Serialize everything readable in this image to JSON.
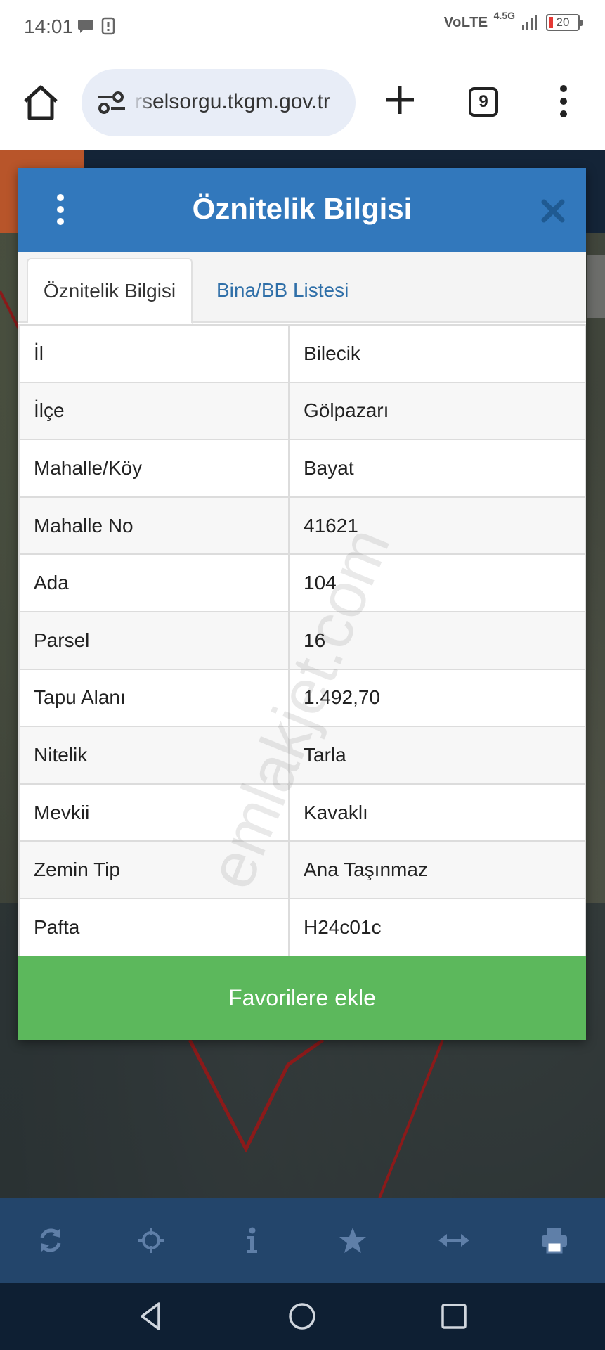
{
  "status_bar": {
    "time": "14:01",
    "volte": "VoLTE",
    "network": "4.5G",
    "battery": "20",
    "battery_color": "#e53935"
  },
  "browser": {
    "url": "rselsorgu.tkgm.gov.tr",
    "tab_count": "9",
    "icons": [
      "home-icon",
      "site-settings-icon",
      "new-tab-plus-icon",
      "tab-switcher-icon",
      "more-vert-icon"
    ]
  },
  "panel": {
    "title": "Öznitelik Bilgisi",
    "header_color": "#3278bc",
    "tabs": [
      {
        "label": "Öznitelik Bilgisi",
        "active": true
      },
      {
        "label": "Bina/BB Listesi",
        "active": false
      }
    ],
    "rows": [
      {
        "key": "İl",
        "value": "Bilecik"
      },
      {
        "key": "İlçe",
        "value": "Gölpazarı"
      },
      {
        "key": "Mahalle/Köy",
        "value": "Bayat"
      },
      {
        "key": "Mahalle No",
        "value": "41621"
      },
      {
        "key": "Ada",
        "value": "104"
      },
      {
        "key": "Parsel",
        "value": "16"
      },
      {
        "key": "Tapu Alanı",
        "value": "1.492,70"
      },
      {
        "key": "Nitelik",
        "value": "Tarla"
      },
      {
        "key": "Mevkii",
        "value": "Kavaklı"
      },
      {
        "key": "Zemin Tip",
        "value": "Ana Taşınmaz"
      },
      {
        "key": "Pafta",
        "value": "H24c01c"
      }
    ],
    "favorite_button": "Favorilere ekle",
    "favorite_color": "#5cb85c"
  },
  "watermark": "emlakjet.com",
  "app_toolbar": {
    "icons": [
      "refresh-icon",
      "crosshair-icon",
      "info-icon",
      "star-icon",
      "measure-icon",
      "print-icon"
    ],
    "color": "#23456b"
  },
  "android_nav": {
    "icons": [
      "back-icon",
      "home-circle-icon",
      "recents-icon"
    ]
  }
}
